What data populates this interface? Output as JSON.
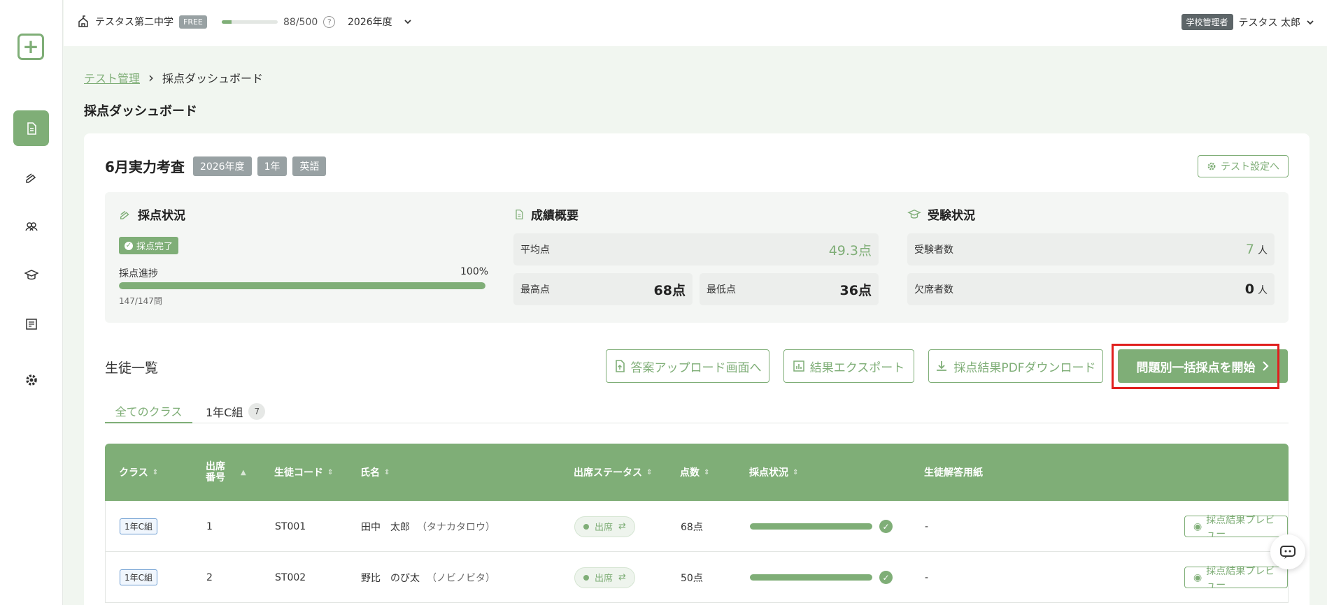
{
  "topbar": {
    "school_name": "テスタス第二中学",
    "plan_badge": "FREE",
    "quota_text": "88/500",
    "quota_fraction": 0.176,
    "help_glyph": "?",
    "year": "2026年度",
    "role": "学校管理者",
    "user_name": "テスタス 太郎"
  },
  "sidebar": {
    "logo_glyph": "+",
    "items": [
      {
        "name": "test-management",
        "icon": "document-icon",
        "active": true
      },
      {
        "name": "grading",
        "icon": "pen-icon",
        "active": false
      },
      {
        "name": "students",
        "icon": "people-icon",
        "active": false
      },
      {
        "name": "graduation",
        "icon": "graduation-cap-icon",
        "active": false
      },
      {
        "name": "answer-sheets",
        "icon": "sheet-icon",
        "active": false
      },
      {
        "name": "settings",
        "icon": "gear-icon",
        "active": false
      }
    ]
  },
  "breadcrumb": {
    "parent": "テスト管理",
    "separator": "›",
    "current": "採点ダッシュボード"
  },
  "page_title": "採点ダッシュボード",
  "test": {
    "name": "6月実力考査",
    "tags": [
      "2026年度",
      "1年",
      "英語"
    ],
    "settings_button": "テスト設定へ"
  },
  "grading_status": {
    "title": "採点状況",
    "badge": "採点完了",
    "progress_label": "採点進捗",
    "progress_percent": "100%",
    "progress_value": 1.0,
    "progress_count": "147/147問"
  },
  "score_summary": {
    "title": "成績概要",
    "average_label": "平均点",
    "average_value": "49.3点",
    "max_label": "最高点",
    "max_value": "68点",
    "min_label": "最低点",
    "min_value": "36点"
  },
  "exam_status": {
    "title": "受験状況",
    "takers_label": "受験者数",
    "takers_value": "7",
    "absent_label": "欠席者数",
    "absent_value": "0",
    "unit": "人"
  },
  "students": {
    "title": "生徒一覧",
    "buttons": {
      "upload": "答案アップロード画面へ",
      "export": "結果エクスポート",
      "pdf": "採点結果PDFダウンロード",
      "bulk": "問題別一括採点を開始"
    },
    "tabs": [
      {
        "label": "全てのクラス",
        "count": ""
      },
      {
        "label": "1年C組",
        "count": "7"
      }
    ],
    "columns": {
      "class": "クラス",
      "number": "出席\n番号",
      "code": "生徒コード",
      "name": "氏名",
      "attendance": "出席ステータス",
      "score": "点数",
      "grading": "採点状況",
      "sheet": "生徒解答用紙"
    },
    "rows": [
      {
        "class": "1年C組",
        "number": "1",
        "code": "ST001",
        "name": "田中　太郎",
        "kana": "（タナカタロウ）",
        "attendance": "出席",
        "score": "68点",
        "sheet": "-",
        "preview": "採点結果プレビュー"
      },
      {
        "class": "1年C組",
        "number": "2",
        "code": "ST002",
        "name": "野比　のび太",
        "kana": "（ノビノビタ）",
        "attendance": "出席",
        "score": "50点",
        "sheet": "-",
        "preview": "採点結果プレビュー"
      }
    ]
  },
  "colors": {
    "accent": "#7fae77",
    "highlight": "#e0201e",
    "tag": "#98a1a3"
  }
}
